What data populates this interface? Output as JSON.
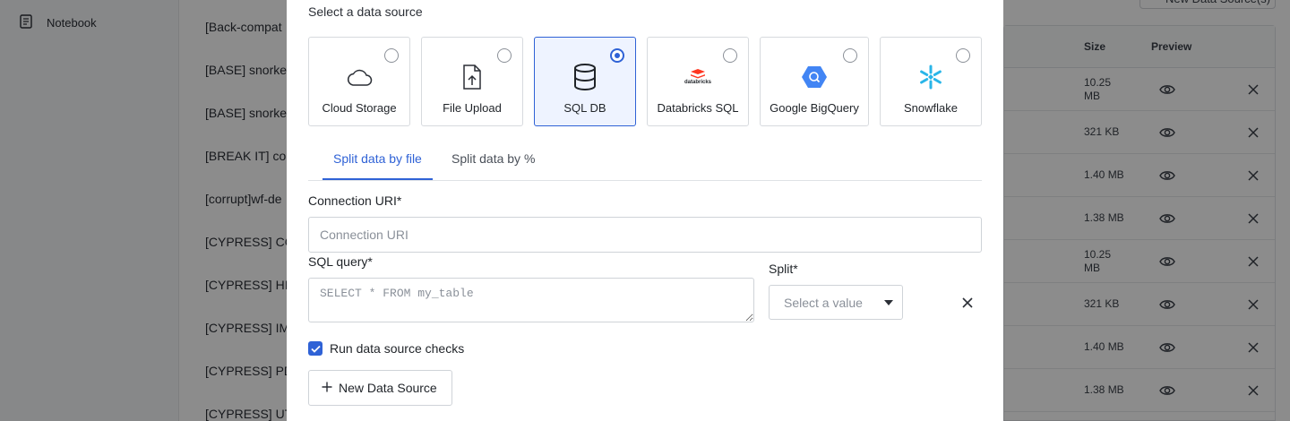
{
  "sidebar": {
    "items": [
      {
        "label": "Notebook",
        "icon": "notebook-icon"
      }
    ]
  },
  "background_list": {
    "rows": [
      "[Back-compat",
      "[BASE] snorke",
      "[BASE] snorke",
      "[BREAK IT] co",
      "[corrupt]wf-de",
      "[CYPRESS] CC",
      "[CYPRESS] HI",
      "[CYPRESS] IM",
      "[CYPRESS] PD",
      "[CYPRESS] UT"
    ]
  },
  "background_table": {
    "top_button_label": "New Data Source(s)",
    "headers": {
      "size": "Size",
      "preview": "Preview"
    },
    "rows": [
      {
        "size": "10.25 MB"
      },
      {
        "size": "321 KB"
      },
      {
        "size": "1.40 MB"
      },
      {
        "size": "1.38 MB"
      },
      {
        "size": "10.25 MB"
      },
      {
        "size": "321 KB"
      },
      {
        "size": "1.40 MB"
      },
      {
        "size": "1.38 MB"
      }
    ]
  },
  "modal": {
    "section_title": "Select a data source",
    "sources": [
      {
        "label": "Cloud Storage",
        "icon": "cloud-icon",
        "selected": false
      },
      {
        "label": "File Upload",
        "icon": "file-upload-icon",
        "selected": false
      },
      {
        "label": "SQL DB",
        "icon": "database-icon",
        "selected": true
      },
      {
        "label": "Databricks SQL",
        "icon": "databricks-logo",
        "selected": false
      },
      {
        "label": "Google BigQuery",
        "icon": "bigquery-logo",
        "selected": false
      },
      {
        "label": "Snowflake",
        "icon": "snowflake-logo",
        "selected": false
      }
    ],
    "databricks_logo_text": "databricks",
    "tabs": [
      {
        "label": "Split data by file",
        "active": true
      },
      {
        "label": "Split data by %",
        "active": false
      }
    ],
    "connection_uri": {
      "label": "Connection URI*",
      "placeholder": "Connection URI",
      "value": ""
    },
    "sql_query": {
      "label": "SQL query*",
      "placeholder": "SELECT * FROM my_table",
      "value": ""
    },
    "split": {
      "label": "Split*",
      "placeholder": "Select a value"
    },
    "run_checks": {
      "label": "Run data source checks",
      "checked": true
    },
    "new_source_button": "New Data Source"
  },
  "colors": {
    "accent": "#2f62d6",
    "selected_tile_bg": "#eef3ff",
    "bigquery_blue": "#4285f4",
    "snowflake_blue": "#29b5e8",
    "databricks_red": "#ff3621"
  }
}
